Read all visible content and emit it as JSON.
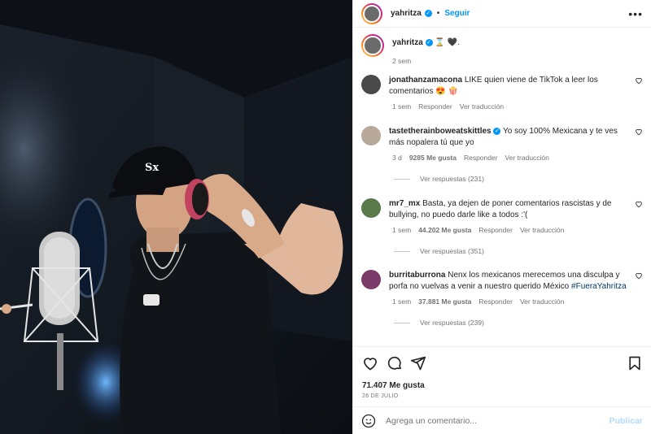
{
  "header": {
    "username": "yahritza",
    "follow_label": "Seguir",
    "separator": "•",
    "more": "•••"
  },
  "caption": {
    "username": "yahritza",
    "text": "⌛ 🖤.",
    "time": "2 sem"
  },
  "comments": [
    {
      "username": "jonathanzamacona",
      "verified": false,
      "text": "LIKE quien viene de TikTok a leer los comentarios 😍 🍿",
      "time": "1 sem",
      "likes": "",
      "reply": "Responder",
      "translate": "Ver traducción",
      "replies": ""
    },
    {
      "username": "tastetherainboweatskittles",
      "verified": true,
      "text": "Yo soy 100% Mexicana y te ves más nopalera tú que yo",
      "time": "3 d",
      "likes": "9285 Me gusta",
      "reply": "Responder",
      "translate": "Ver traducción",
      "replies": "Ver respuestas (231)"
    },
    {
      "username": "mr7_mx",
      "verified": false,
      "text": "Basta, ya dejen de poner comentarios rascistas y de bullying, no puedo darle like a todos :'(",
      "time": "1 sem",
      "likes": "44.202 Me gusta",
      "reply": "Responder",
      "translate": "Ver traducción",
      "replies": "Ver respuestas (351)"
    },
    {
      "username": "burritaburrona",
      "verified": false,
      "text": "Nenx los mexicanos merecemos una disculpa y porfa no vuelvas a venir a nuestro querido México",
      "hashtag": "#FueraYahritza",
      "time": "1 sem",
      "likes": "37.881 Me gusta",
      "reply": "Responder",
      "translate": "Ver traducción",
      "replies": "Ver respuestas (239)"
    }
  ],
  "footer": {
    "likes": "71.407 Me gusta",
    "date": "26 DE JULIO",
    "comment_placeholder": "Agrega un comentario...",
    "publish": "Publicar"
  },
  "colors": {
    "accent": "#0095f6",
    "text": "#262626",
    "muted": "#737373"
  }
}
